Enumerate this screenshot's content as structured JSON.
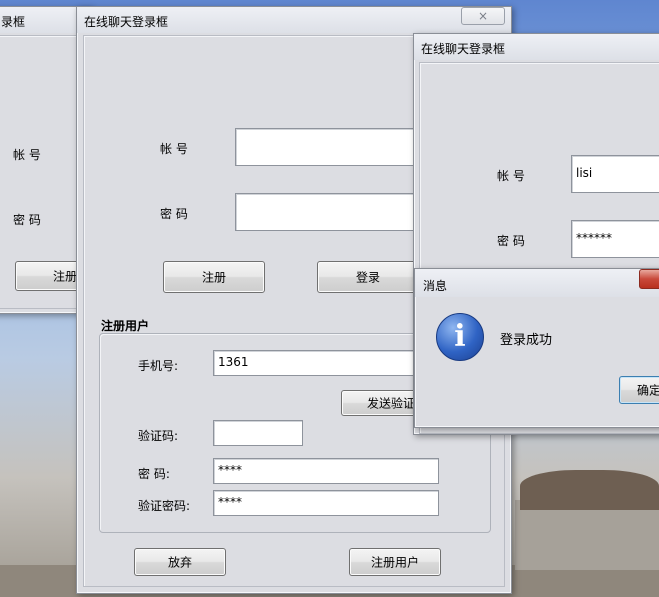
{
  "colors": {
    "accent": "#2f63c4",
    "close_red": "#c9493a"
  },
  "background_window": {
    "title": "录框",
    "account_label": "帐  号",
    "password_label": "密  码",
    "register_button": "注册"
  },
  "main_window": {
    "title": "在线聊天登录框",
    "close_icon": "×",
    "account_label": "帐  号",
    "password_label": "密  码",
    "account_value": "",
    "password_value": "",
    "register_button": "注册",
    "login_button": "登录",
    "register_section": {
      "title": "注册用户",
      "phone_label": "手机号:",
      "phone_value": "1361",
      "send_code_button": "发送验证",
      "code_label": "验证码:",
      "code_value": "",
      "password_label": "密    码:",
      "password_value": "****",
      "confirm_password_label": "验证密码:",
      "confirm_password_value": "****",
      "cancel_button": "放弃",
      "submit_button": "注册用户"
    }
  },
  "right_window": {
    "title": "在线聊天登录框",
    "account_label": "帐  号",
    "password_label": "密  码",
    "account_value": "lisi",
    "password_value": "******"
  },
  "message_dialog": {
    "title": "消息",
    "icon": "info-icon",
    "icon_glyph": "i",
    "message": "登录成功",
    "ok_button": "确定"
  }
}
